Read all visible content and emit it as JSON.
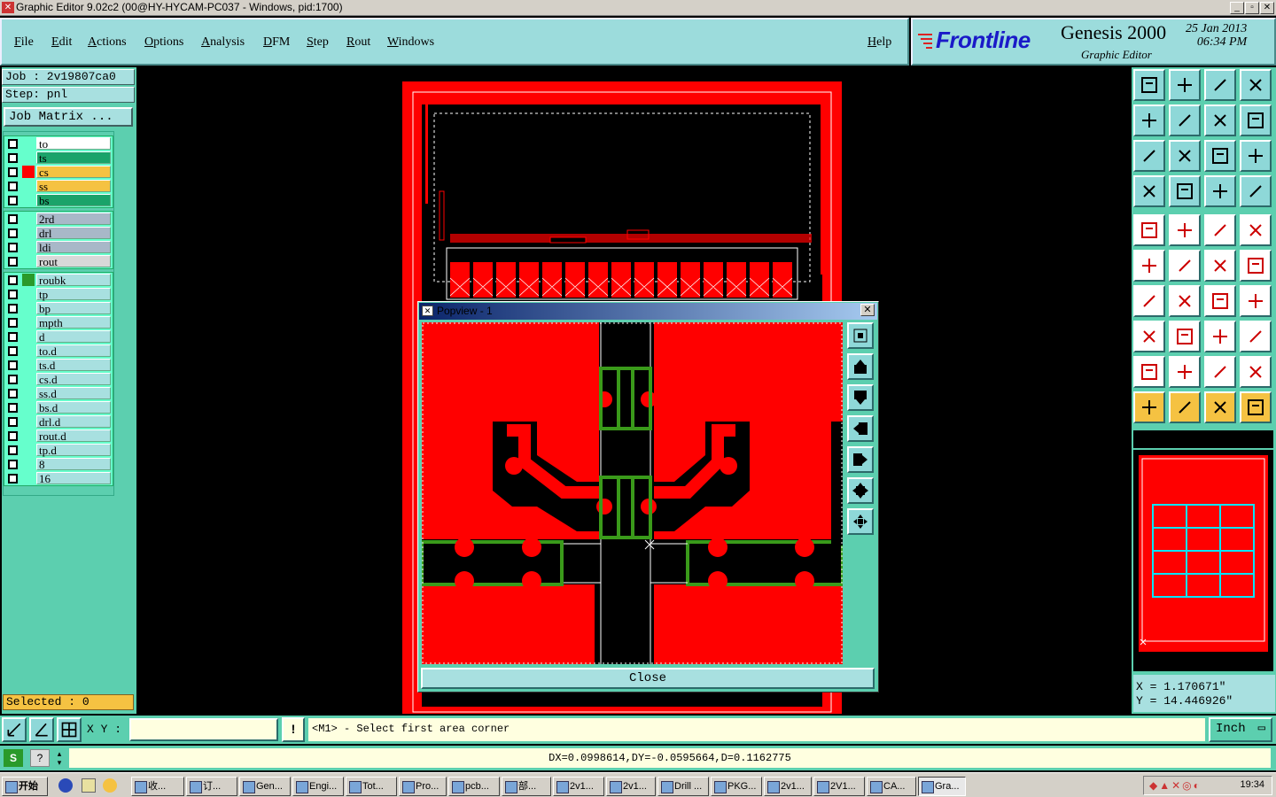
{
  "window": {
    "title": "Graphic Editor 9.02c2 (00@HY-HYCAM-PC037 - Windows, pid:1700)"
  },
  "menu": {
    "items": [
      "File",
      "Edit",
      "Actions",
      "Options",
      "Analysis",
      "DFM",
      "Step",
      "Rout",
      "Windows"
    ],
    "help": "Help"
  },
  "brand": {
    "logo": "Frontline",
    "product": "Genesis 2000",
    "subtitle": "Graphic Editor",
    "date": "25 Jan 2013",
    "time": "06:34 PM"
  },
  "job": {
    "job_line": "Job : 2v19807ca0",
    "step_line": "Step: pnl",
    "matrix_button": "Job Matrix ..."
  },
  "layers_group1": [
    {
      "name": "to",
      "color": "#ffffff",
      "swatch": ""
    },
    {
      "name": "ts",
      "color": "#1aa36a",
      "swatch": ""
    },
    {
      "name": "cs",
      "color": "#f5c242",
      "swatch": "#ff0000"
    },
    {
      "name": "ss",
      "color": "#f5c242",
      "swatch": ""
    },
    {
      "name": "bs",
      "color": "#1aa36a",
      "swatch": ""
    }
  ],
  "layers_group2": [
    {
      "name": "2rd",
      "color": "#a8b8c8"
    },
    {
      "name": "drl",
      "color": "#a8b8c8"
    },
    {
      "name": "ldi",
      "color": "#a8b8c8"
    },
    {
      "name": "rout",
      "color": "#d8d8d8"
    }
  ],
  "layers_group3": [
    {
      "name": "roubk",
      "swatch": "#2a9a2a"
    },
    {
      "name": "tp"
    },
    {
      "name": "bp"
    },
    {
      "name": "mpth"
    },
    {
      "name": "d"
    },
    {
      "name": "to.d"
    },
    {
      "name": "ts.d"
    },
    {
      "name": "cs.d"
    },
    {
      "name": "ss.d"
    },
    {
      "name": "bs.d"
    },
    {
      "name": "drl.d"
    },
    {
      "name": "rout.d"
    },
    {
      "name": "tp.d"
    },
    {
      "name": "8"
    },
    {
      "name": "16"
    }
  ],
  "selected": "Selected : 0",
  "popview": {
    "title": "Popview - 1",
    "close_label": "Close",
    "close_x": "✕"
  },
  "coords": {
    "x": "X = 1.170671\"",
    "y": "Y = 14.446926\""
  },
  "bottom": {
    "xy_label": "X Y :",
    "xy_value": "",
    "prompt": "<M1> - Select first area corner",
    "unit": "Inch",
    "info_icon": "!"
  },
  "measure": "DX=0.0998614,DY=-0.0595664,D=0.1162775",
  "taskbar": {
    "start": "开始",
    "tasks": [
      "收...",
      "订...",
      "Gen...",
      "Engi...",
      "Tot...",
      "Pro...",
      "pcb...",
      "部...",
      "2v1...",
      "2v1...",
      "Drill ...",
      "PKG...",
      "2v1...",
      "2V1...",
      "CA...",
      "Gra..."
    ],
    "clock": "19:34"
  },
  "colors": {
    "panel": "#5ccfaf",
    "board": "#ff0000",
    "accent": "#f5c242",
    "pad_green": "#3a9a1a"
  }
}
